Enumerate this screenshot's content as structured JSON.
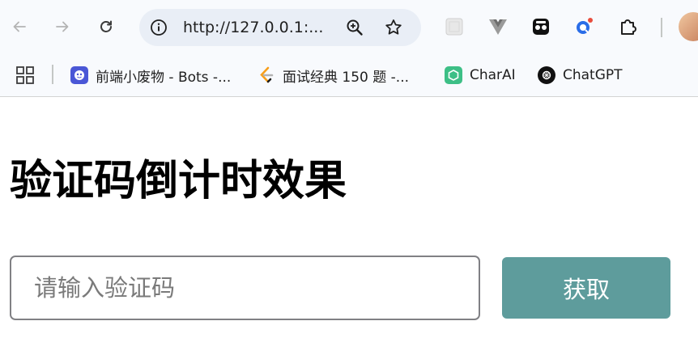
{
  "browser": {
    "url": "http://127.0.0.1:...",
    "extensions": [
      "generic-extension-icon",
      "vue-devtools-icon",
      "tab-manager-icon",
      "search-extension-icon",
      "puzzle-extensions-icon"
    ]
  },
  "bookmarks": {
    "items": [
      {
        "label": "前端小废物 - Bots -...",
        "icon": "bots-icon",
        "color": "#4a57d6"
      },
      {
        "label": "面试经典 150 题 -...",
        "icon": "leetcode-icon",
        "color": "#f89f1b"
      },
      {
        "label": "CharAI",
        "icon": "charai-icon",
        "color": "#3dbf86"
      },
      {
        "label": "ChatGPT",
        "icon": "openai-icon",
        "color": "#111111"
      }
    ]
  },
  "page": {
    "title": "验证码倒计时效果",
    "input_placeholder": "请输入验证码",
    "input_value": "",
    "button_label": "获取",
    "button_color": "#5e9c9c"
  }
}
